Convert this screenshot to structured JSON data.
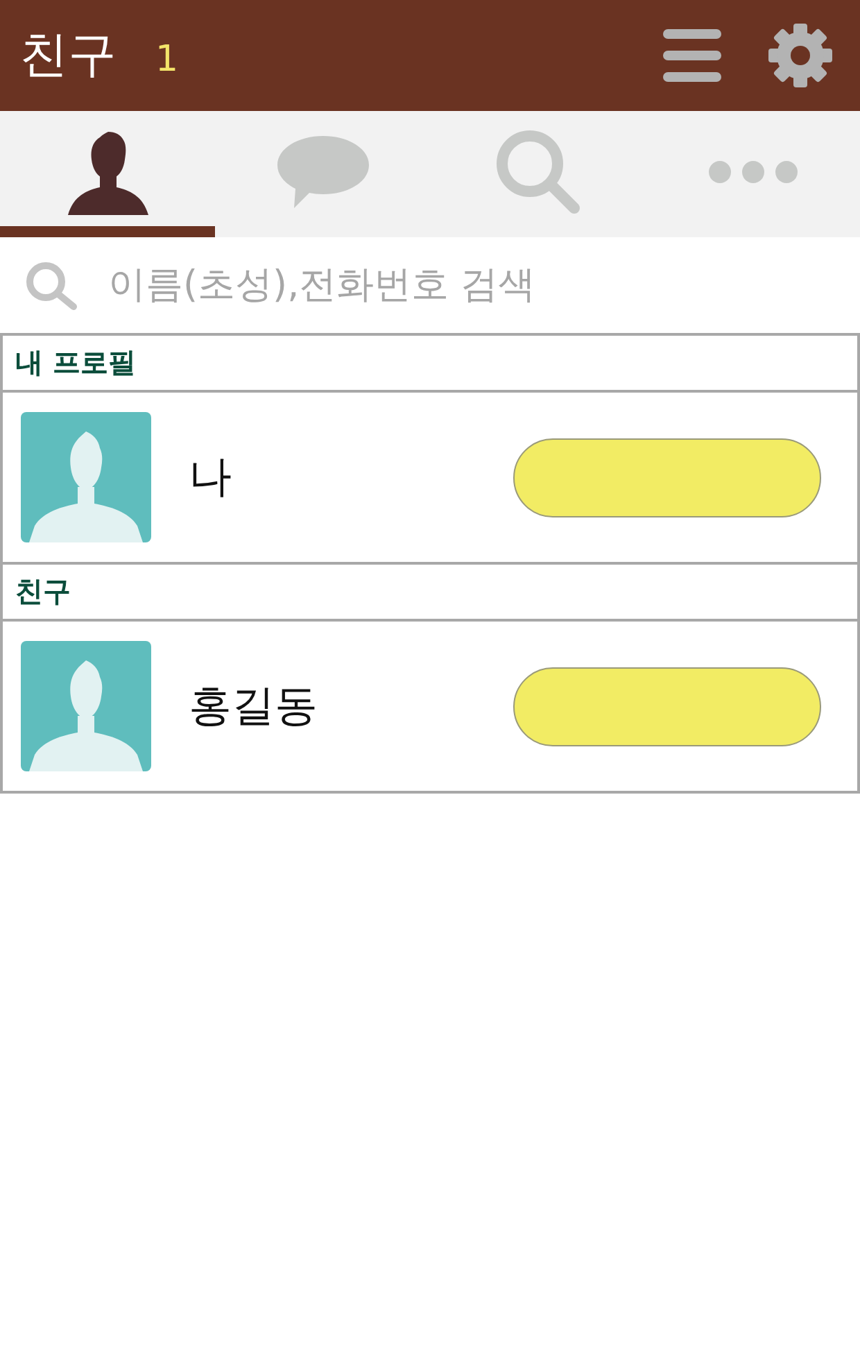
{
  "header": {
    "title": "친구",
    "count": "1"
  },
  "tabs": [
    {
      "kind": "friends",
      "selected": true
    },
    {
      "kind": "chats",
      "selected": false
    },
    {
      "kind": "search",
      "selected": false
    },
    {
      "kind": "more",
      "selected": false
    }
  ],
  "search": {
    "placeholder": "이름(초성),전화번호 검색"
  },
  "sections": [
    {
      "title": "내 프로필",
      "friends": [
        {
          "name": "나"
        }
      ]
    },
    {
      "title": "친구",
      "friends": [
        {
          "name": "홍길동"
        }
      ]
    }
  ]
}
